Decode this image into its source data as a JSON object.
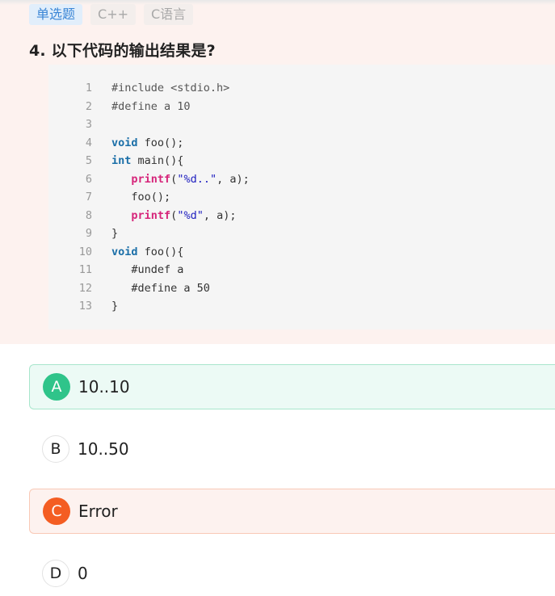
{
  "tags": [
    "单选题",
    "C++",
    "C语言"
  ],
  "question": {
    "title": "4. 以下代码的输出结果是?"
  },
  "code": {
    "lines": [
      {
        "num": "1",
        "segments": [
          {
            "t": "pp",
            "v": "#include <stdio.h>"
          }
        ]
      },
      {
        "num": "2",
        "segments": [
          {
            "t": "pp",
            "v": "#define a 10"
          }
        ]
      },
      {
        "num": "3",
        "segments": []
      },
      {
        "num": "4",
        "segments": [
          {
            "t": "kw",
            "v": "void"
          },
          {
            "t": "p",
            "v": " foo();"
          }
        ]
      },
      {
        "num": "5",
        "segments": [
          {
            "t": "kw",
            "v": "int"
          },
          {
            "t": "p",
            "v": " main(){"
          }
        ]
      },
      {
        "num": "6",
        "segments": [
          {
            "t": "p",
            "v": "   "
          },
          {
            "t": "fn",
            "v": "printf"
          },
          {
            "t": "p",
            "v": "("
          },
          {
            "t": "str",
            "v": "\"%d..\""
          },
          {
            "t": "p",
            "v": ", a);"
          }
        ]
      },
      {
        "num": "7",
        "segments": [
          {
            "t": "p",
            "v": "   foo();"
          }
        ]
      },
      {
        "num": "8",
        "segments": [
          {
            "t": "p",
            "v": "   "
          },
          {
            "t": "fn",
            "v": "printf"
          },
          {
            "t": "p",
            "v": "("
          },
          {
            "t": "str",
            "v": "\"%d\""
          },
          {
            "t": "p",
            "v": ", a);"
          }
        ]
      },
      {
        "num": "9",
        "segments": [
          {
            "t": "p",
            "v": "}"
          }
        ]
      },
      {
        "num": "10",
        "segments": [
          {
            "t": "kw",
            "v": "void"
          },
          {
            "t": "p",
            "v": " foo(){"
          }
        ]
      },
      {
        "num": "11",
        "segments": [
          {
            "t": "p",
            "v": "   #undef a"
          }
        ]
      },
      {
        "num": "12",
        "segments": [
          {
            "t": "p",
            "v": "   #define a 50"
          }
        ]
      },
      {
        "num": "13",
        "segments": [
          {
            "t": "p",
            "v": "}"
          }
        ]
      }
    ]
  },
  "options": [
    {
      "letter": "A",
      "text": "10..10",
      "state": "correct"
    },
    {
      "letter": "B",
      "text": "10..50",
      "state": "plain"
    },
    {
      "letter": "C",
      "text": "Error",
      "state": "wrong"
    },
    {
      "letter": "D",
      "text": "0",
      "state": "plain"
    }
  ],
  "colors": {
    "correct": "#2fc48a",
    "wrong": "#f45d22",
    "tag_primary": "#3b86d6"
  }
}
